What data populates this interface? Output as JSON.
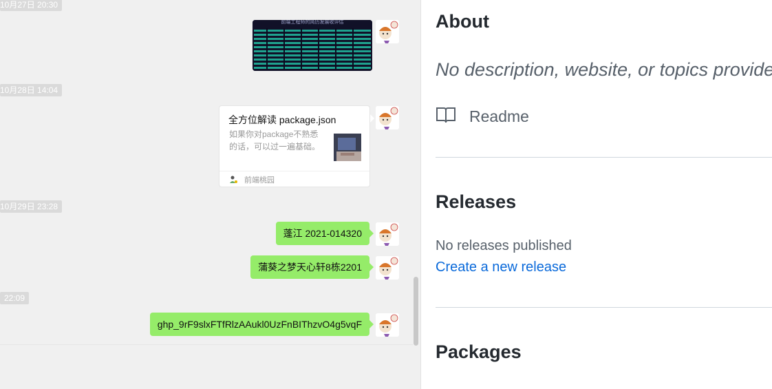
{
  "chat": {
    "timestamps": [
      "10月27日 20:30",
      "10月28日 14:04",
      "10月29日 23:28",
      "22:09"
    ],
    "image_caption": "前端工程师的简历发展收评估",
    "card": {
      "title": "全方位解读 package.json",
      "description": "如果你对package不熟悉的话，可以过一遍基础。",
      "source": "前端桃园"
    },
    "messages": [
      "蓬江 2021-014320",
      "蒲葵之梦天心轩8栋2201",
      "ghp_9rF9slxFTfRlzAAukl0UzFnBIThzvO4g5vqF"
    ],
    "bubble_color": "#95ec69"
  },
  "panel": {
    "about_title": "About",
    "about_desc": "No description, website, or topics provided.",
    "readme_label": "Readme",
    "releases_title": "Releases",
    "releases_empty": "No releases published",
    "releases_link": "Create a new release",
    "packages_title": "Packages",
    "link_color": "#0969da"
  }
}
